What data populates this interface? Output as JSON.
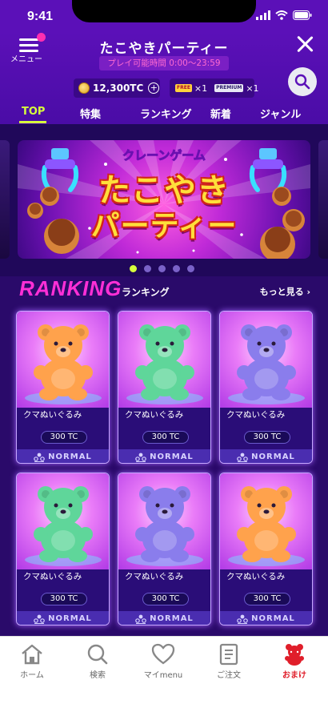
{
  "status": {
    "time": "9:41"
  },
  "header": {
    "menu_label": "メニュー",
    "title": "たこやきパーティー",
    "playtime": "プレイ可能時間 0:00〜23:59",
    "wallet": "12,300TC",
    "tickets": [
      {
        "badge": "FREE",
        "count": "×1"
      },
      {
        "badge": "PREMIUM",
        "count": "×1"
      }
    ]
  },
  "tabs": [
    "TOP",
    "特集",
    "ランキング",
    "新着",
    "ジャンル"
  ],
  "banner": {
    "subtitle": "クレーンゲーム",
    "title_line1": "たこやき",
    "title_line2": "パーティー"
  },
  "ranking": {
    "title": "RANKING",
    "subtitle": "ランキング",
    "more": "もっと見る"
  },
  "items": [
    {
      "name": "クマぬいぐるみ",
      "price": "300 TC",
      "rank": "NORMAL",
      "color": "#ffa24c"
    },
    {
      "name": "クマぬいぐるみ",
      "price": "300 TC",
      "rank": "NORMAL",
      "color": "#5fd69a"
    },
    {
      "name": "クマぬいぐるみ",
      "price": "300 TC",
      "rank": "NORMAL",
      "color": "#8a7dec"
    },
    {
      "name": "クマぬいぐるみ",
      "price": "300 TC",
      "rank": "NORMAL",
      "color": "#5fd69a"
    },
    {
      "name": "クマぬいぐるみ",
      "price": "300 TC",
      "rank": "NORMAL",
      "color": "#8a7dec"
    },
    {
      "name": "クマぬいぐるみ",
      "price": "300 TC",
      "rank": "NORMAL",
      "color": "#ffa24c"
    }
  ],
  "nav": [
    {
      "label": "ホーム",
      "icon": "home-icon"
    },
    {
      "label": "検索",
      "icon": "search-icon"
    },
    {
      "label": "マイmenu",
      "icon": "heart-icon"
    },
    {
      "label": "ご注文",
      "icon": "order-icon"
    },
    {
      "label": "おまけ",
      "icon": "bear-icon"
    }
  ],
  "colors": {
    "accent": "#d7ff3c",
    "ranking": "#ff2fd6",
    "active_nav": "#e01e2a"
  }
}
